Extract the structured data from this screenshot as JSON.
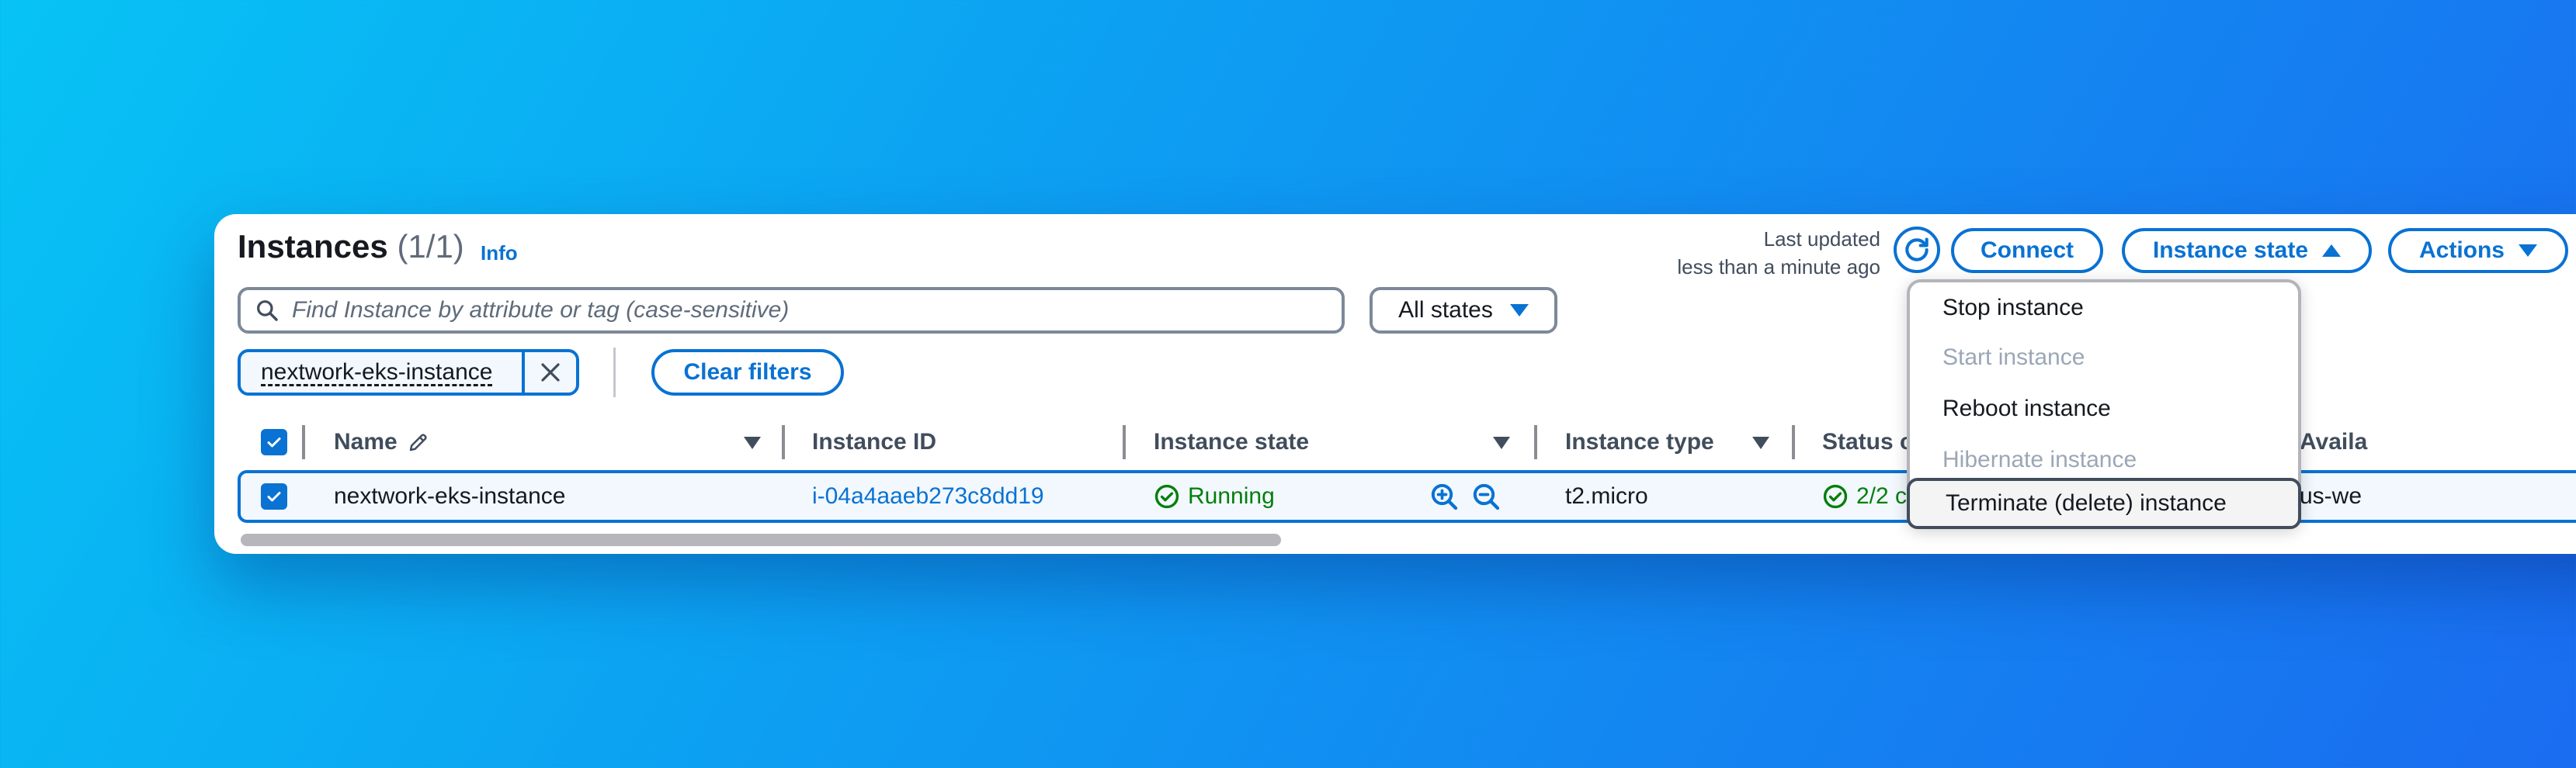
{
  "header": {
    "title": "Instances",
    "count": "(1/1)",
    "info_link": "Info",
    "last_updated_line1": "Last updated",
    "last_updated_line2": "less than a minute ago"
  },
  "toolbar": {
    "refresh_icon": "refresh-icon",
    "connect_label": "Connect",
    "instance_state_label": "Instance state",
    "actions_label": "Actions"
  },
  "search": {
    "placeholder": "Find Instance by attribute or tag (case-sensitive)",
    "icon": "search-icon"
  },
  "states_filter": {
    "selected": "All states"
  },
  "filters": {
    "token_label": "nextwork-eks-instance",
    "clear_label": "Clear filters"
  },
  "table": {
    "columns": [
      "Name",
      "Instance ID",
      "Instance state",
      "Instance type",
      "Status c",
      "Availa"
    ],
    "rows": [
      {
        "name": "nextwork-eks-instance",
        "instance_id": "i-04a4aaeb273c8dd19",
        "state": "Running",
        "type": "t2.micro",
        "status_check": "2/2 c",
        "az": "us-we"
      }
    ]
  },
  "instance_state_menu": {
    "items": [
      {
        "label": "Stop instance",
        "enabled": true
      },
      {
        "label": "Start instance",
        "enabled": false
      },
      {
        "label": "Reboot instance",
        "enabled": true
      },
      {
        "label": "Hibernate instance",
        "enabled": false
      },
      {
        "label": "Terminate (delete) instance",
        "enabled": true,
        "highlighted": true
      }
    ]
  },
  "colors": {
    "accent": "#0972d3",
    "success": "#037f0c",
    "disabled_text": "#9ba7b6"
  }
}
